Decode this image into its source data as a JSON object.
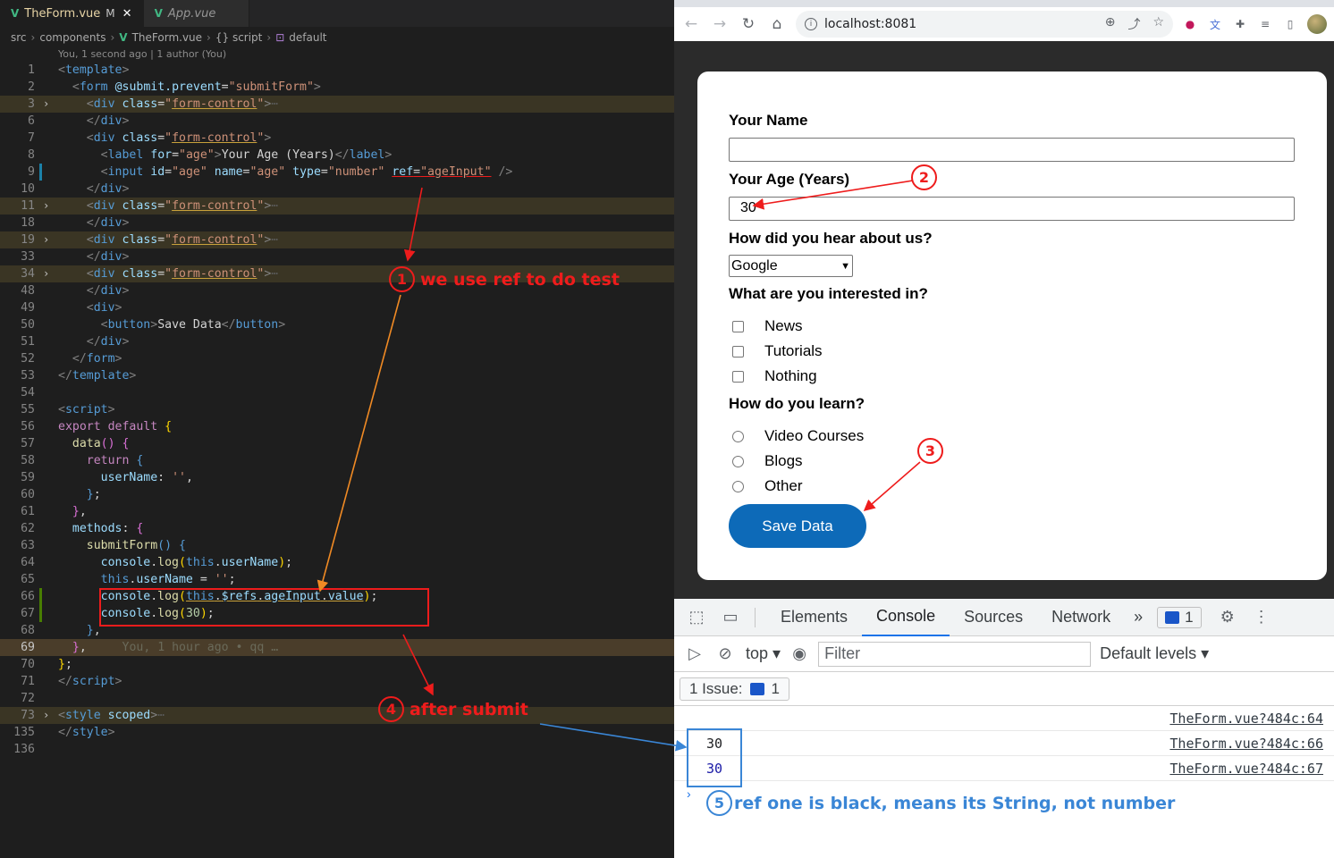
{
  "editor": {
    "tabs": [
      {
        "label": "TheForm.vue",
        "modified": "M",
        "active": true
      },
      {
        "label": "App.vue",
        "active": false
      }
    ],
    "breadcrumb": [
      "src",
      "components",
      "TheForm.vue",
      "{} script",
      "default"
    ],
    "blame_header": "You, 1 second ago | 1 author (You)",
    "inline_blame": "You, 1 hour ago • qq …"
  },
  "annotations": {
    "a1": {
      "num": "1",
      "text": "we use ref to do test"
    },
    "a2": {
      "num": "2"
    },
    "a3": {
      "num": "3"
    },
    "a4": {
      "num": "4",
      "text": "after submit"
    },
    "a5": {
      "num": "5",
      "text": "ref one is black, means its String, not number"
    }
  },
  "browser": {
    "url": "localhost:8081",
    "form": {
      "name_label": "Your Name",
      "name_value": "",
      "age_label": "Your Age (Years)",
      "age_value": "30",
      "referrer_label": "How did you hear about us?",
      "referrer_value": "Google",
      "interest_label": "What are you interested in?",
      "interests": [
        "News",
        "Tutorials",
        "Nothing"
      ],
      "learn_label": "How do you learn?",
      "learn_options": [
        "Video Courses",
        "Blogs",
        "Other"
      ],
      "save_label": "Save Data"
    }
  },
  "devtools": {
    "tabs": [
      "Elements",
      "Console",
      "Sources",
      "Network"
    ],
    "active_tab": "Console",
    "issue_badge_count": "1",
    "context": "top",
    "filter_placeholder": "Filter",
    "levels": "Default levels",
    "issues_label": "1 Issue:",
    "issues_count": "1",
    "console_rows": [
      {
        "value": "",
        "source": "TheForm.vue?484c:64"
      },
      {
        "value": "30",
        "source": "TheForm.vue?484c:66",
        "kind": "string"
      },
      {
        "value": "30",
        "source": "TheForm.vue?484c:67",
        "kind": "number"
      }
    ]
  }
}
